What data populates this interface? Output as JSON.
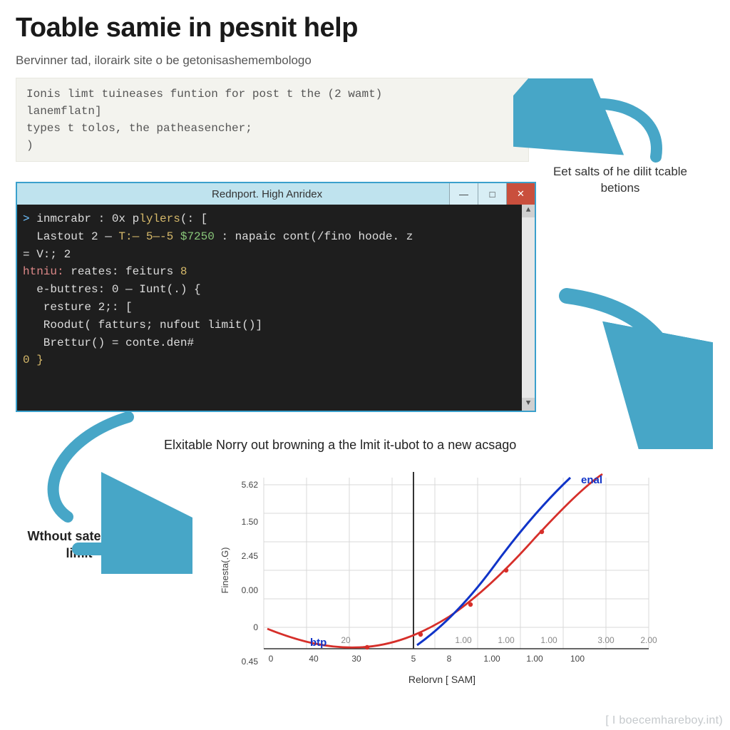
{
  "title": "Toable samie in pesnit help",
  "subtitle": "Bervinner tad, ilorairk site o be getonisashemembologo",
  "code_light": {
    "l1": "Ionis limt tuineases funtion for post t the (2 wamt)",
    "l2": "lanemflatn]",
    "l3": "types t tolos, the patheasencher;",
    "l4": ")"
  },
  "side_label_1": "Eet salts of he dilit tcable betions",
  "terminal": {
    "title": "Rednport. High Anridex",
    "min": "—",
    "max": "□",
    "close": "✕",
    "lines": {
      "l1a": ">",
      "l1b": " inmcrabr : 0x p",
      "l1c": "lylers",
      "l1d": "(: [",
      "l2a": "  Lastout 2 — ",
      "l2b": "T:— 5—-5 ",
      "l2c": "$7250",
      "l2d": " : napaic cont(/fino hoode. z",
      "l3": "= V:; 2",
      "l4a": "htniu:",
      "l4b": " reates: feiturs ",
      "l4c": "8",
      "l5": "  e-buttres: 0 — Iunt(.) {",
      "l6": "   resture 2;: [",
      "l7": "   Roodut( fatturs; nufout limit()]",
      "l8": "   Brettur() = conte.den#",
      "l9": "0 }"
    }
  },
  "mid_caption": "Elxitable Norry out browning a the lmit it-ubot to a new acsago",
  "label_left": "Wthout sates the limit",
  "chart_data": {
    "type": "line",
    "title": "",
    "xlabel": "Relorvn [ SAM]",
    "ylabel": "Finesta(.G)",
    "x_ticks": [
      "0",
      "40",
      "30",
      "5",
      "8",
      "1.00",
      "1.00",
      "100"
    ],
    "x_ticks2": [
      "20",
      "1.00",
      "1.00",
      "1.00",
      "3.00",
      "2.00"
    ],
    "y_ticks": [
      "0.45",
      "0",
      "0.00",
      "2.45",
      "1.50",
      "5.62"
    ],
    "series": [
      {
        "name": "enal",
        "color": "#1034c8",
        "points": [
          {
            "x": 0.42,
            "y": 0.04
          },
          {
            "x": 0.5,
            "y": 0.2
          },
          {
            "x": 0.6,
            "y": 0.48
          },
          {
            "x": 0.72,
            "y": 0.82
          },
          {
            "x": 0.82,
            "y": 1.0
          }
        ]
      },
      {
        "name": "btp",
        "color": "#d62f2a",
        "points": [
          {
            "x": 0.0,
            "y": 0.12
          },
          {
            "x": 0.12,
            "y": 0.04
          },
          {
            "x": 0.24,
            "y": 0.0
          },
          {
            "x": 0.36,
            "y": 0.02
          },
          {
            "x": 0.5,
            "y": 0.12
          },
          {
            "x": 0.62,
            "y": 0.34
          },
          {
            "x": 0.74,
            "y": 0.62
          },
          {
            "x": 0.86,
            "y": 0.92
          }
        ]
      }
    ],
    "legend": {
      "enal": "enal",
      "btp": "btp"
    }
  },
  "watermark": "[ I boecemhareboy.int)",
  "colors": {
    "arrow": "#47a6c7"
  }
}
